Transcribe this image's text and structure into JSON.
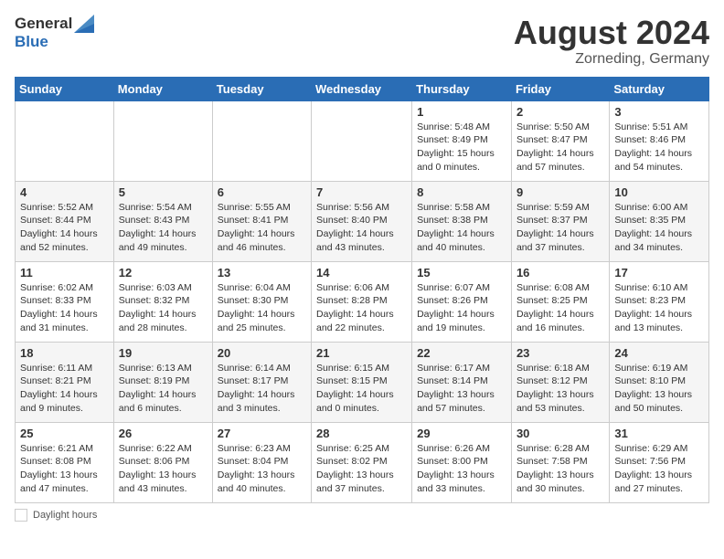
{
  "header": {
    "logo_line1": "General",
    "logo_line2": "Blue",
    "title": "August 2024",
    "subtitle": "Zorneding, Germany"
  },
  "weekdays": [
    "Sunday",
    "Monday",
    "Tuesday",
    "Wednesday",
    "Thursday",
    "Friday",
    "Saturday"
  ],
  "weeks": [
    [
      {
        "day": "",
        "info": ""
      },
      {
        "day": "",
        "info": ""
      },
      {
        "day": "",
        "info": ""
      },
      {
        "day": "",
        "info": ""
      },
      {
        "day": "1",
        "info": "Sunrise: 5:48 AM\nSunset: 8:49 PM\nDaylight: 15 hours\nand 0 minutes."
      },
      {
        "day": "2",
        "info": "Sunrise: 5:50 AM\nSunset: 8:47 PM\nDaylight: 14 hours\nand 57 minutes."
      },
      {
        "day": "3",
        "info": "Sunrise: 5:51 AM\nSunset: 8:46 PM\nDaylight: 14 hours\nand 54 minutes."
      }
    ],
    [
      {
        "day": "4",
        "info": "Sunrise: 5:52 AM\nSunset: 8:44 PM\nDaylight: 14 hours\nand 52 minutes."
      },
      {
        "day": "5",
        "info": "Sunrise: 5:54 AM\nSunset: 8:43 PM\nDaylight: 14 hours\nand 49 minutes."
      },
      {
        "day": "6",
        "info": "Sunrise: 5:55 AM\nSunset: 8:41 PM\nDaylight: 14 hours\nand 46 minutes."
      },
      {
        "day": "7",
        "info": "Sunrise: 5:56 AM\nSunset: 8:40 PM\nDaylight: 14 hours\nand 43 minutes."
      },
      {
        "day": "8",
        "info": "Sunrise: 5:58 AM\nSunset: 8:38 PM\nDaylight: 14 hours\nand 40 minutes."
      },
      {
        "day": "9",
        "info": "Sunrise: 5:59 AM\nSunset: 8:37 PM\nDaylight: 14 hours\nand 37 minutes."
      },
      {
        "day": "10",
        "info": "Sunrise: 6:00 AM\nSunset: 8:35 PM\nDaylight: 14 hours\nand 34 minutes."
      }
    ],
    [
      {
        "day": "11",
        "info": "Sunrise: 6:02 AM\nSunset: 8:33 PM\nDaylight: 14 hours\nand 31 minutes."
      },
      {
        "day": "12",
        "info": "Sunrise: 6:03 AM\nSunset: 8:32 PM\nDaylight: 14 hours\nand 28 minutes."
      },
      {
        "day": "13",
        "info": "Sunrise: 6:04 AM\nSunset: 8:30 PM\nDaylight: 14 hours\nand 25 minutes."
      },
      {
        "day": "14",
        "info": "Sunrise: 6:06 AM\nSunset: 8:28 PM\nDaylight: 14 hours\nand 22 minutes."
      },
      {
        "day": "15",
        "info": "Sunrise: 6:07 AM\nSunset: 8:26 PM\nDaylight: 14 hours\nand 19 minutes."
      },
      {
        "day": "16",
        "info": "Sunrise: 6:08 AM\nSunset: 8:25 PM\nDaylight: 14 hours\nand 16 minutes."
      },
      {
        "day": "17",
        "info": "Sunrise: 6:10 AM\nSunset: 8:23 PM\nDaylight: 14 hours\nand 13 minutes."
      }
    ],
    [
      {
        "day": "18",
        "info": "Sunrise: 6:11 AM\nSunset: 8:21 PM\nDaylight: 14 hours\nand 9 minutes."
      },
      {
        "day": "19",
        "info": "Sunrise: 6:13 AM\nSunset: 8:19 PM\nDaylight: 14 hours\nand 6 minutes."
      },
      {
        "day": "20",
        "info": "Sunrise: 6:14 AM\nSunset: 8:17 PM\nDaylight: 14 hours\nand 3 minutes."
      },
      {
        "day": "21",
        "info": "Sunrise: 6:15 AM\nSunset: 8:15 PM\nDaylight: 14 hours\nand 0 minutes."
      },
      {
        "day": "22",
        "info": "Sunrise: 6:17 AM\nSunset: 8:14 PM\nDaylight: 13 hours\nand 57 minutes."
      },
      {
        "day": "23",
        "info": "Sunrise: 6:18 AM\nSunset: 8:12 PM\nDaylight: 13 hours\nand 53 minutes."
      },
      {
        "day": "24",
        "info": "Sunrise: 6:19 AM\nSunset: 8:10 PM\nDaylight: 13 hours\nand 50 minutes."
      }
    ],
    [
      {
        "day": "25",
        "info": "Sunrise: 6:21 AM\nSunset: 8:08 PM\nDaylight: 13 hours\nand 47 minutes."
      },
      {
        "day": "26",
        "info": "Sunrise: 6:22 AM\nSunset: 8:06 PM\nDaylight: 13 hours\nand 43 minutes."
      },
      {
        "day": "27",
        "info": "Sunrise: 6:23 AM\nSunset: 8:04 PM\nDaylight: 13 hours\nand 40 minutes."
      },
      {
        "day": "28",
        "info": "Sunrise: 6:25 AM\nSunset: 8:02 PM\nDaylight: 13 hours\nand 37 minutes."
      },
      {
        "day": "29",
        "info": "Sunrise: 6:26 AM\nSunset: 8:00 PM\nDaylight: 13 hours\nand 33 minutes."
      },
      {
        "day": "30",
        "info": "Sunrise: 6:28 AM\nSunset: 7:58 PM\nDaylight: 13 hours\nand 30 minutes."
      },
      {
        "day": "31",
        "info": "Sunrise: 6:29 AM\nSunset: 7:56 PM\nDaylight: 13 hours\nand 27 minutes."
      }
    ]
  ],
  "footer": {
    "daylight_label": "Daylight hours"
  }
}
